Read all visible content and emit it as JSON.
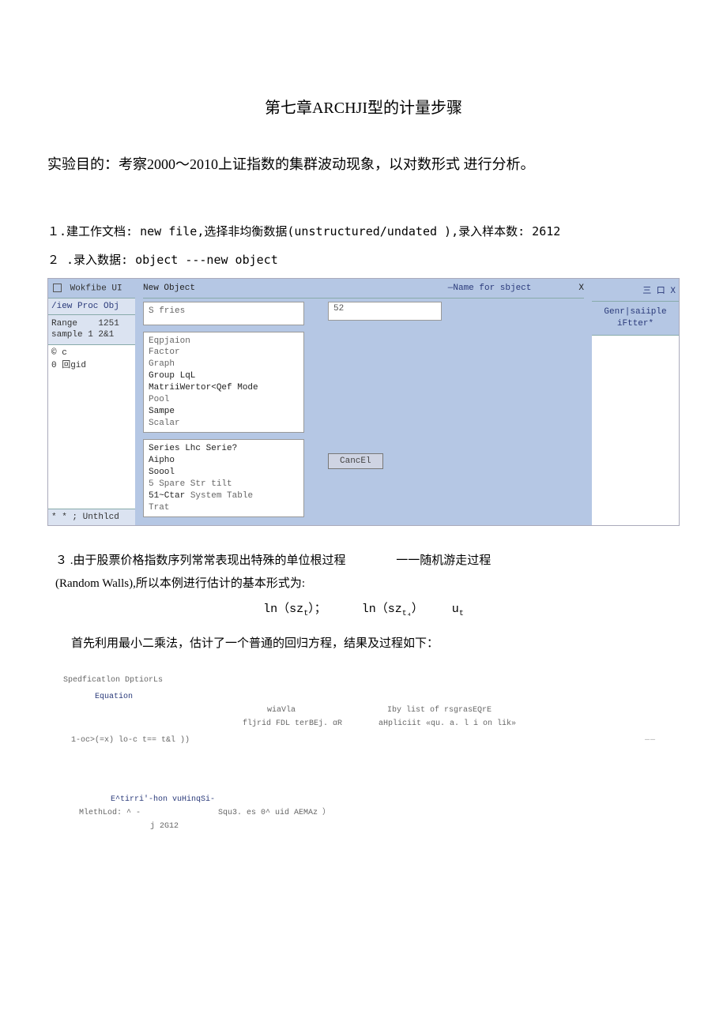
{
  "title": "第七章ARCHJI型的计量步骤",
  "intro": "实验目的：考察2000～2010上证指数的集群波动现象，以对数形式  进行分析。",
  "step1": "１.建工作文档: new file,选择非均衡数据(unstructured/undated ),录入样本数: 2612",
  "step2": "２ .录入数据: object ---new object",
  "win": {
    "left_title_prefix": "回",
    "left_title": "Wokfibe UI",
    "left_menu": "/iew Proc Obj",
    "range_label": "Range",
    "range_val": "1251",
    "sample_label": "sample 1 2&1",
    "c_row": "© c",
    "g_row": "0 回gid",
    "left_footer": "* * ;  Unthlcd",
    "new_object": "New Object",
    "name_for": "—Name for sbject",
    "close_x": "X",
    "type_sel": "S fries",
    "name_val": "52",
    "types1": [
      "Eqpjaion",
      "Factor",
      "Graph",
      "Group LqL",
      "MatriiWertor<Qef Mode",
      "Pool",
      "Sampe",
      "Scalar"
    ],
    "types2": [
      "Series Lhc Serie?",
      "Aipho",
      "Soool",
      "5 Spare Str tilt",
      "51~Ctar System Table",
      "Trat"
    ],
    "cancel": "CancEl",
    "right_controls": "三 口 X",
    "right_menu1": "Genr|saiiple",
    "right_menu2": "iFtter*"
  },
  "p3a": "３ .由于股票价格指数序列常常表现出特殊的单位根过程",
  "p3b": "一一随机游走过程",
  "p3c": "(Random Walls),所以本例进行估计的基本形式为:",
  "formula_l": "ln（sz",
  "formula_l2": "）；",
  "formula_r": "ln（sz",
  "formula_r2": "）",
  "formula_u": "u",
  "sub_t": "t",
  "sub_t4": "t₄",
  "p4": "首先利用最小二乘法，估计了一个普通的回归方程，结果及过程如下：",
  "spec": {
    "tabs": "Spedficatlon DptiorLs",
    "eqlabel": "Equation",
    "wia": "wiaVla",
    "iby": "Iby list of rsgrasEQrE",
    "fl": "fljrid FDL terBEj. αR",
    "ahp": "aHpliciit «qu. a. l i on lik»",
    "expr": "1-oc>(=x) lo-c t== t&l ))",
    "dash": "——",
    "sec2_title": "E^tirri'-hon vuHinqSi-",
    "method": "MlethLod: ^ -",
    "squ": "Squ3. es 0^ uid AEMAz ）",
    "j": "j 2G12"
  }
}
